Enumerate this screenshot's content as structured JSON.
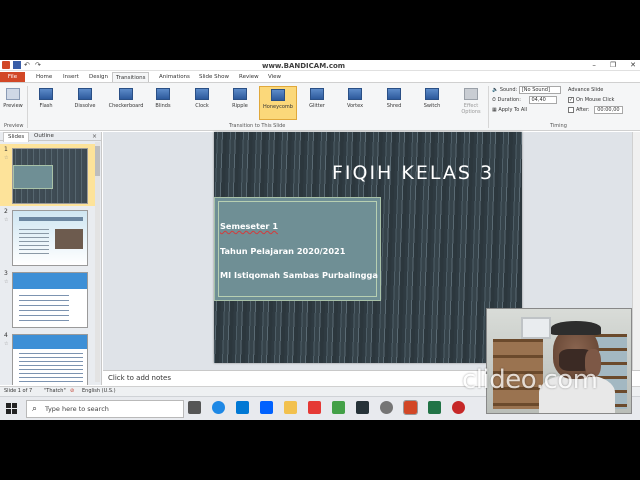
{
  "recorder_watermark": "www.BANDICAM.com",
  "editor_watermark": "clideo.com",
  "ribbon_tabs": [
    "File",
    "Home",
    "Insert",
    "Design",
    "Transitions",
    "Animations",
    "Slide Show",
    "Review",
    "View"
  ],
  "active_tab": "Transitions",
  "ribbon": {
    "preview_label": "Preview",
    "preview_group": "Preview",
    "transitions": [
      "Flash",
      "Dissolve",
      "Checkerboard",
      "Blinds",
      "Clock",
      "Ripple",
      "Honeycomb",
      "Glitter",
      "Vortex",
      "Shred",
      "Switch"
    ],
    "selected_transition": "Honeycomb",
    "transition_group": "Transition to This Slide",
    "effect_options": "Effect Options",
    "timing": {
      "sound_label": "Sound:",
      "sound_value": "[No Sound]",
      "duration_label": "Duration:",
      "duration_value": "04,40",
      "apply_to_all": "Apply To All",
      "advance_slide": "Advance Slide",
      "on_mouse_click": "On Mouse Click",
      "after_label": "After:",
      "after_value": "00:00,00",
      "group": "Timing"
    }
  },
  "left_pane": {
    "tabs": [
      "Slides",
      "Outline"
    ],
    "close": "×",
    "slide_numbers": [
      "1",
      "2",
      "3",
      "4"
    ]
  },
  "slide": {
    "title": "FIQIH KELAS 3",
    "lines": [
      "Semeseter 1",
      "Tahun Pelajaran 2020/2021",
      "MI Istiqomah Sambas Purbalingga"
    ]
  },
  "notes_placeholder": "Click to add notes",
  "status_bar": {
    "slide_counter": "Slide 1 of 7",
    "theme": "\"Thatch\"",
    "language": "English (U.S.)"
  },
  "taskbar": {
    "search_placeholder": "Type here to search"
  },
  "colors": {
    "file_tab": "#d24726",
    "selected_transition": "#fbd87a",
    "slide_box": "#6f8f95"
  }
}
